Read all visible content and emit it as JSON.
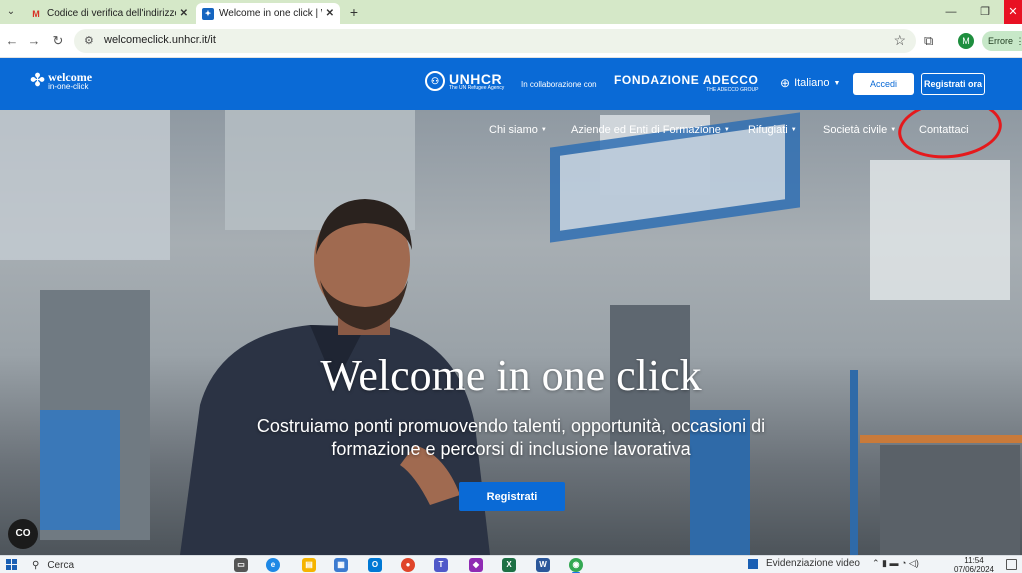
{
  "browser": {
    "tabs": [
      {
        "title": "Codice di verifica dell'indirizzo",
        "favicon": "gmail-icon",
        "active": false
      },
      {
        "title": "Welcome in one click | Welcome",
        "favicon": "site-icon",
        "active": true
      }
    ],
    "url": "welcomeclick.unhcr.it/it",
    "profile_initial": "M",
    "error_label": "Errore"
  },
  "header": {
    "logo_line1": "welcome",
    "logo_line2": "in-one-click",
    "unhcr_name": "UNHCR",
    "unhcr_tagline": "The UN Refugee Agency",
    "collab_text": "In collaborazione con",
    "partner_name": "FONDAZIONE ADECCO",
    "partner_tagline": "THE ADECCO GROUP",
    "language": "Italiano",
    "login_label": "Accedi",
    "register_label": "Registrati ora"
  },
  "nav": {
    "items": [
      "Chi siamo",
      "Aziende ed Enti di Formazione",
      "Rifugiati",
      "Società civile",
      "Contattaci"
    ]
  },
  "hero": {
    "title": "Welcome in one click",
    "subtitle_line1": "Costruiamo ponti promuovendo talenti, opportunità, occasioni di",
    "subtitle_line2": "formazione e percorsi di inclusione lavorativa",
    "cta_label": "Registrati"
  },
  "floating_button_label": "CO",
  "taskbar": {
    "search_placeholder": "Cerca",
    "news_label": "Evidenziazione video",
    "time": "11:54",
    "date": "07/06/2024"
  },
  "colors": {
    "brand_blue": "#0a6ad6",
    "annotation_red": "#e5191c",
    "tab_strip": "#d5e8c8"
  }
}
